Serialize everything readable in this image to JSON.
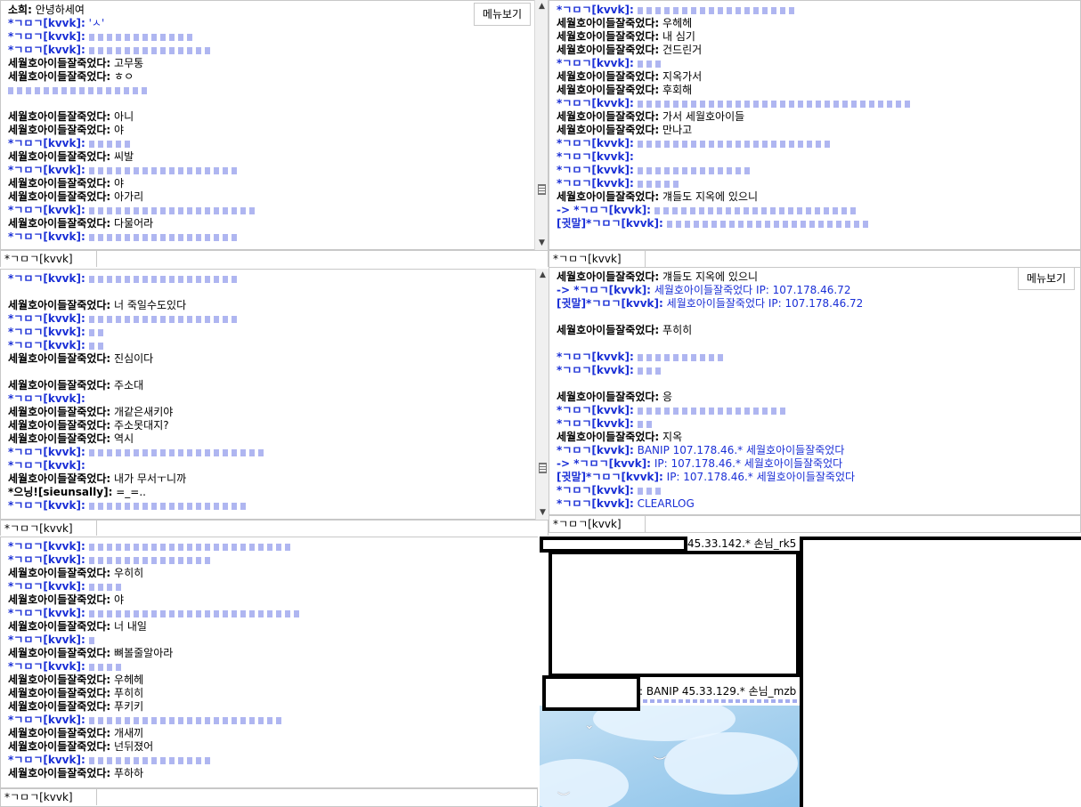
{
  "panes": {
    "top_left": {
      "menu_label": "메뉴보기",
      "input_nick": "*ㄱㅁㄱ[kvvk]",
      "lines": [
        {
          "nick": "소희:",
          "text": "안녕하세여",
          "color": "black",
          "redact": 0
        },
        {
          "nick": "*ㄱㅁㄱ[kvvk]:",
          "text": "'ㅅ'",
          "color": "blue",
          "redact": 0
        },
        {
          "nick": "*ㄱㅁㄱ[kvvk]:",
          "text": "",
          "color": "blue",
          "redact": 120
        },
        {
          "nick": "*ㄱㅁㄱ[kvvk]:",
          "text": "",
          "color": "blue",
          "redact": 140
        },
        {
          "nick": "세월호아이들잘죽었다:",
          "text": "고무통",
          "color": "black",
          "redact": 0
        },
        {
          "nick": "세월호아이들잘죽었다:",
          "text": "ㅎㅇ",
          "color": "black",
          "redact": 0
        },
        {
          "nick": "",
          "text": "",
          "color": "blue",
          "redact": 160
        },
        {
          "nick": "",
          "text": "",
          "color": "black",
          "redact": 0
        },
        {
          "nick": "세월호아이들잘죽었다:",
          "text": "아니",
          "color": "black",
          "redact": 0
        },
        {
          "nick": "세월호아이들잘죽었다:",
          "text": "야",
          "color": "black",
          "redact": 0
        },
        {
          "nick": "*ㄱㅁㄱ[kvvk]:",
          "text": "",
          "color": "blue",
          "redact": 50
        },
        {
          "nick": "세월호아이들잘죽었다:",
          "text": "씨발",
          "color": "black",
          "redact": 0
        },
        {
          "nick": "*ㄱㅁㄱ[kvvk]:",
          "text": "",
          "color": "blue",
          "redact": 170
        },
        {
          "nick": "세월호아이들잘죽었다:",
          "text": "야",
          "color": "black",
          "redact": 0
        },
        {
          "nick": "세월호아이들잘죽었다:",
          "text": "아가리",
          "color": "black",
          "redact": 0
        },
        {
          "nick": "*ㄱㅁㄱ[kvvk]:",
          "text": "",
          "color": "blue",
          "redact": 190
        },
        {
          "nick": "세월호아이들잘죽었다:",
          "text": "다물어라",
          "color": "black",
          "redact": 0
        },
        {
          "nick": "*ㄱㅁㄱ[kvvk]:",
          "text": "",
          "color": "blue",
          "redact": 170
        }
      ]
    },
    "top_right": {
      "input_nick": "*ㄱㅁㄱ[kvvk]",
      "lines": [
        {
          "nick": "*ㄱㅁㄱ[kvvk]:",
          "text": "",
          "color": "blue",
          "redact": 180
        },
        {
          "nick": "세월호아이들잘죽었다:",
          "text": "우헤헤",
          "color": "black",
          "redact": 0
        },
        {
          "nick": "세월호아이들잘죽었다:",
          "text": "내 심기",
          "color": "black",
          "redact": 0
        },
        {
          "nick": "세월호아이들잘죽었다:",
          "text": "건드린거",
          "color": "black",
          "redact": 0
        },
        {
          "nick": "*ㄱㅁㄱ[kvvk]:",
          "text": "",
          "color": "blue",
          "redact": 30
        },
        {
          "nick": "세월호아이들잘죽었다:",
          "text": "지옥가서",
          "color": "black",
          "redact": 0
        },
        {
          "nick": "세월호아이들잘죽었다:",
          "text": "후회해",
          "color": "black",
          "redact": 0
        },
        {
          "nick": "*ㄱㅁㄱ[kvvk]:",
          "text": "",
          "color": "blue",
          "redact": 310
        },
        {
          "nick": "세월호아이들잘죽었다:",
          "text": "가서 세월호아이들",
          "color": "black",
          "redact": 0
        },
        {
          "nick": "세월호아이들잘죽었다:",
          "text": "만나고",
          "color": "black",
          "redact": 0
        },
        {
          "nick": "*ㄱㅁㄱ[kvvk]:",
          "text": "",
          "color": "blue",
          "redact": 220
        },
        {
          "nick": "*ㄱㅁㄱ[kvvk]:",
          "text": "",
          "color": "blue",
          "redact": 0
        },
        {
          "nick": "*ㄱㅁㄱ[kvvk]:",
          "text": "",
          "color": "blue",
          "redact": 130
        },
        {
          "nick": "*ㄱㅁㄱ[kvvk]:",
          "text": "",
          "color": "blue",
          "redact": 50
        },
        {
          "nick": "세월호아이들잘죽었다:",
          "text": "걔들도 지옥에 있으니",
          "color": "black",
          "redact": 0
        },
        {
          "nick": "-> *ㄱㅁㄱ[kvvk]:",
          "text": "",
          "color": "blue",
          "redact": 230
        },
        {
          "nick": "[귓말]*ㄱㅁㄱ[kvvk]:",
          "text": "",
          "color": "blue",
          "redact": 230
        }
      ]
    },
    "mid_left": {
      "input_nick": "*ㄱㅁㄱ[kvvk]",
      "lines": [
        {
          "nick": "*ㄱㅁㄱ[kvvk]:",
          "text": "",
          "color": "blue",
          "redact": 170
        },
        {
          "nick": "",
          "text": "",
          "color": "black",
          "redact": 0
        },
        {
          "nick": "세월호아이들잘죽었다:",
          "text": "너 죽일수도있다",
          "color": "black",
          "redact": 0
        },
        {
          "nick": "*ㄱㅁㄱ[kvvk]:",
          "text": "",
          "color": "blue",
          "redact": 170
        },
        {
          "nick": "*ㄱㅁㄱ[kvvk]:",
          "text": "",
          "color": "blue",
          "redact": 20
        },
        {
          "nick": "*ㄱㅁㄱ[kvvk]:",
          "text": "",
          "color": "blue",
          "redact": 20
        },
        {
          "nick": "세월호아이들잘죽었다:",
          "text": "진심이다",
          "color": "black",
          "redact": 0
        },
        {
          "nick": "",
          "text": "",
          "color": "black",
          "redact": 0
        },
        {
          "nick": "세월호아이들잘죽었다:",
          "text": "주소대",
          "color": "black",
          "redact": 0
        },
        {
          "nick": "*ㄱㅁㄱ[kvvk]:",
          "text": "",
          "color": "blue",
          "redact": 0
        },
        {
          "nick": "세월호아이들잘죽었다:",
          "text": "개같은새키야",
          "color": "black",
          "redact": 0
        },
        {
          "nick": "세월호아이들잘죽었다:",
          "text": "주소못대지?",
          "color": "black",
          "redact": 0
        },
        {
          "nick": "세월호아이들잘죽었다:",
          "text": "역시",
          "color": "black",
          "redact": 0
        },
        {
          "nick": "*ㄱㅁㄱ[kvvk]:",
          "text": "",
          "color": "blue",
          "redact": 200
        },
        {
          "nick": "*ㄱㅁㄱ[kvvk]:",
          "text": "",
          "color": "blue",
          "redact": 0
        },
        {
          "nick": "세월호아이들잘죽었다:",
          "text": "내가 무서ㅜ니까",
          "color": "black",
          "redact": 0
        },
        {
          "nick": "*으닝![sieunsally]:",
          "text": "=_=..",
          "color": "black",
          "redact": 0
        },
        {
          "nick": "*ㄱㅁㄱ[kvvk]:",
          "text": "",
          "color": "blue",
          "redact": 180
        }
      ]
    },
    "mid_right": {
      "menu_label": "메뉴보기",
      "input_nick": "*ㄱㅁㄱ[kvvk]",
      "lines": [
        {
          "nick": "세월호아이들잘죽었다:",
          "text": "걔들도 지옥에 있으니",
          "color": "black",
          "redact": 0
        },
        {
          "nick": "-> *ㄱㅁㄱ[kvvk]:",
          "text": "세월호아이들잘죽었다 IP: 107.178.46.72",
          "color": "blue",
          "redact": 0
        },
        {
          "nick": "[귓말]*ㄱㅁㄱ[kvvk]:",
          "text": "세월호아이들잘죽었다 IP: 107.178.46.72",
          "color": "blue",
          "redact": 0
        },
        {
          "nick": "",
          "text": "",
          "color": "black",
          "redact": 0
        },
        {
          "nick": "세월호아이들잘죽었다:",
          "text": "푸히히",
          "color": "black",
          "redact": 0
        },
        {
          "nick": "",
          "text": "",
          "color": "black",
          "redact": 0
        },
        {
          "nick": "*ㄱㅁㄱ[kvvk]:",
          "text": "",
          "color": "blue",
          "redact": 100
        },
        {
          "nick": "*ㄱㅁㄱ[kvvk]:",
          "text": "",
          "color": "blue",
          "redact": 30
        },
        {
          "nick": "",
          "text": "",
          "color": "black",
          "redact": 0
        },
        {
          "nick": "세월호아이들잘죽었다:",
          "text": "응",
          "color": "black",
          "redact": 0
        },
        {
          "nick": "*ㄱㅁㄱ[kvvk]:",
          "text": "",
          "color": "blue",
          "redact": 170
        },
        {
          "nick": "*ㄱㅁㄱ[kvvk]:",
          "text": "",
          "color": "blue",
          "redact": 20
        },
        {
          "nick": "세월호아이들잘죽었다:",
          "text": "지옥",
          "color": "black",
          "redact": 0
        },
        {
          "nick": "*ㄱㅁㄱ[kvvk]:",
          "text": "BANIP 107.178.46.* 세월호아이들잘죽었다",
          "color": "blue",
          "redact": 0
        },
        {
          "nick": "-> *ㄱㅁㄱ[kvvk]:",
          "text": "IP: 107.178.46.* 세월호아이들잘죽었다",
          "color": "blue",
          "redact": 0
        },
        {
          "nick": "[귓말]*ㄱㅁㄱ[kvvk]:",
          "text": "IP: 107.178.46.* 세월호아이들잘죽었다",
          "color": "blue",
          "redact": 0
        },
        {
          "nick": "*ㄱㅁㄱ[kvvk]:",
          "text": "",
          "color": "blue",
          "redact": 30
        },
        {
          "nick": "*ㄱㅁㄱ[kvvk]:",
          "text": "CLEARLOG",
          "color": "blue",
          "redact": 0
        }
      ]
    },
    "bottom_left": {
      "input_nick": "*ㄱㅁㄱ[kvvk]",
      "lines": [
        {
          "nick": "*ㄱㅁㄱ[kvvk]:",
          "text": "",
          "color": "blue",
          "redact": 230
        },
        {
          "nick": "*ㄱㅁㄱ[kvvk]:",
          "text": "",
          "color": "blue",
          "redact": 140
        },
        {
          "nick": "세월호아이들잘죽었다:",
          "text": "우히히",
          "color": "black",
          "redact": 0
        },
        {
          "nick": "*ㄱㅁㄱ[kvvk]:",
          "text": "",
          "color": "blue",
          "redact": 40
        },
        {
          "nick": "세월호아이들잘죽었다:",
          "text": "야",
          "color": "black",
          "redact": 0
        },
        {
          "nick": "*ㄱㅁㄱ[kvvk]:",
          "text": "",
          "color": "blue",
          "redact": 240
        },
        {
          "nick": "세월호아이들잘죽었다:",
          "text": "너 내일",
          "color": "black",
          "redact": 0
        },
        {
          "nick": "*ㄱㅁㄱ[kvvk]:",
          "text": "",
          "color": "blue",
          "redact": 10
        },
        {
          "nick": "세월호아이들잘죽었다:",
          "text": "뼈볼줄알아라",
          "color": "black",
          "redact": 0
        },
        {
          "nick": "*ㄱㅁㄱ[kvvk]:",
          "text": "",
          "color": "blue",
          "redact": 40
        },
        {
          "nick": "세월호아이들잘죽었다:",
          "text": "우헤헤",
          "color": "black",
          "redact": 0
        },
        {
          "nick": "세월호아이들잘죽었다:",
          "text": "푸히히",
          "color": "black",
          "redact": 0
        },
        {
          "nick": "세월호아이들잘죽었다:",
          "text": "푸키키",
          "color": "black",
          "redact": 0
        },
        {
          "nick": "*ㄱㅁㄱ[kvvk]:",
          "text": "",
          "color": "blue",
          "redact": 220
        },
        {
          "nick": "세월호아이들잘죽었다:",
          "text": "개새끼",
          "color": "black",
          "redact": 0
        },
        {
          "nick": "세월호아이들잘죽었다:",
          "text": "넌뒤졌어",
          "color": "black",
          "redact": 0
        },
        {
          "nick": "*ㄱㅁㄱ[kvvk]:",
          "text": "",
          "color": "blue",
          "redact": 140
        },
        {
          "nick": "세월호아이들잘죽었다:",
          "text": "푸하하",
          "color": "black",
          "redact": 0
        }
      ]
    },
    "bottom_right": {
      "top_text": "45.33.142.* 손님_rk5",
      "ban_text": ": BANIP 45.33.129.* 손님_mzb"
    }
  },
  "colors": {
    "blue_nick": "#1a2fd6",
    "border": "#c8c8c8"
  }
}
